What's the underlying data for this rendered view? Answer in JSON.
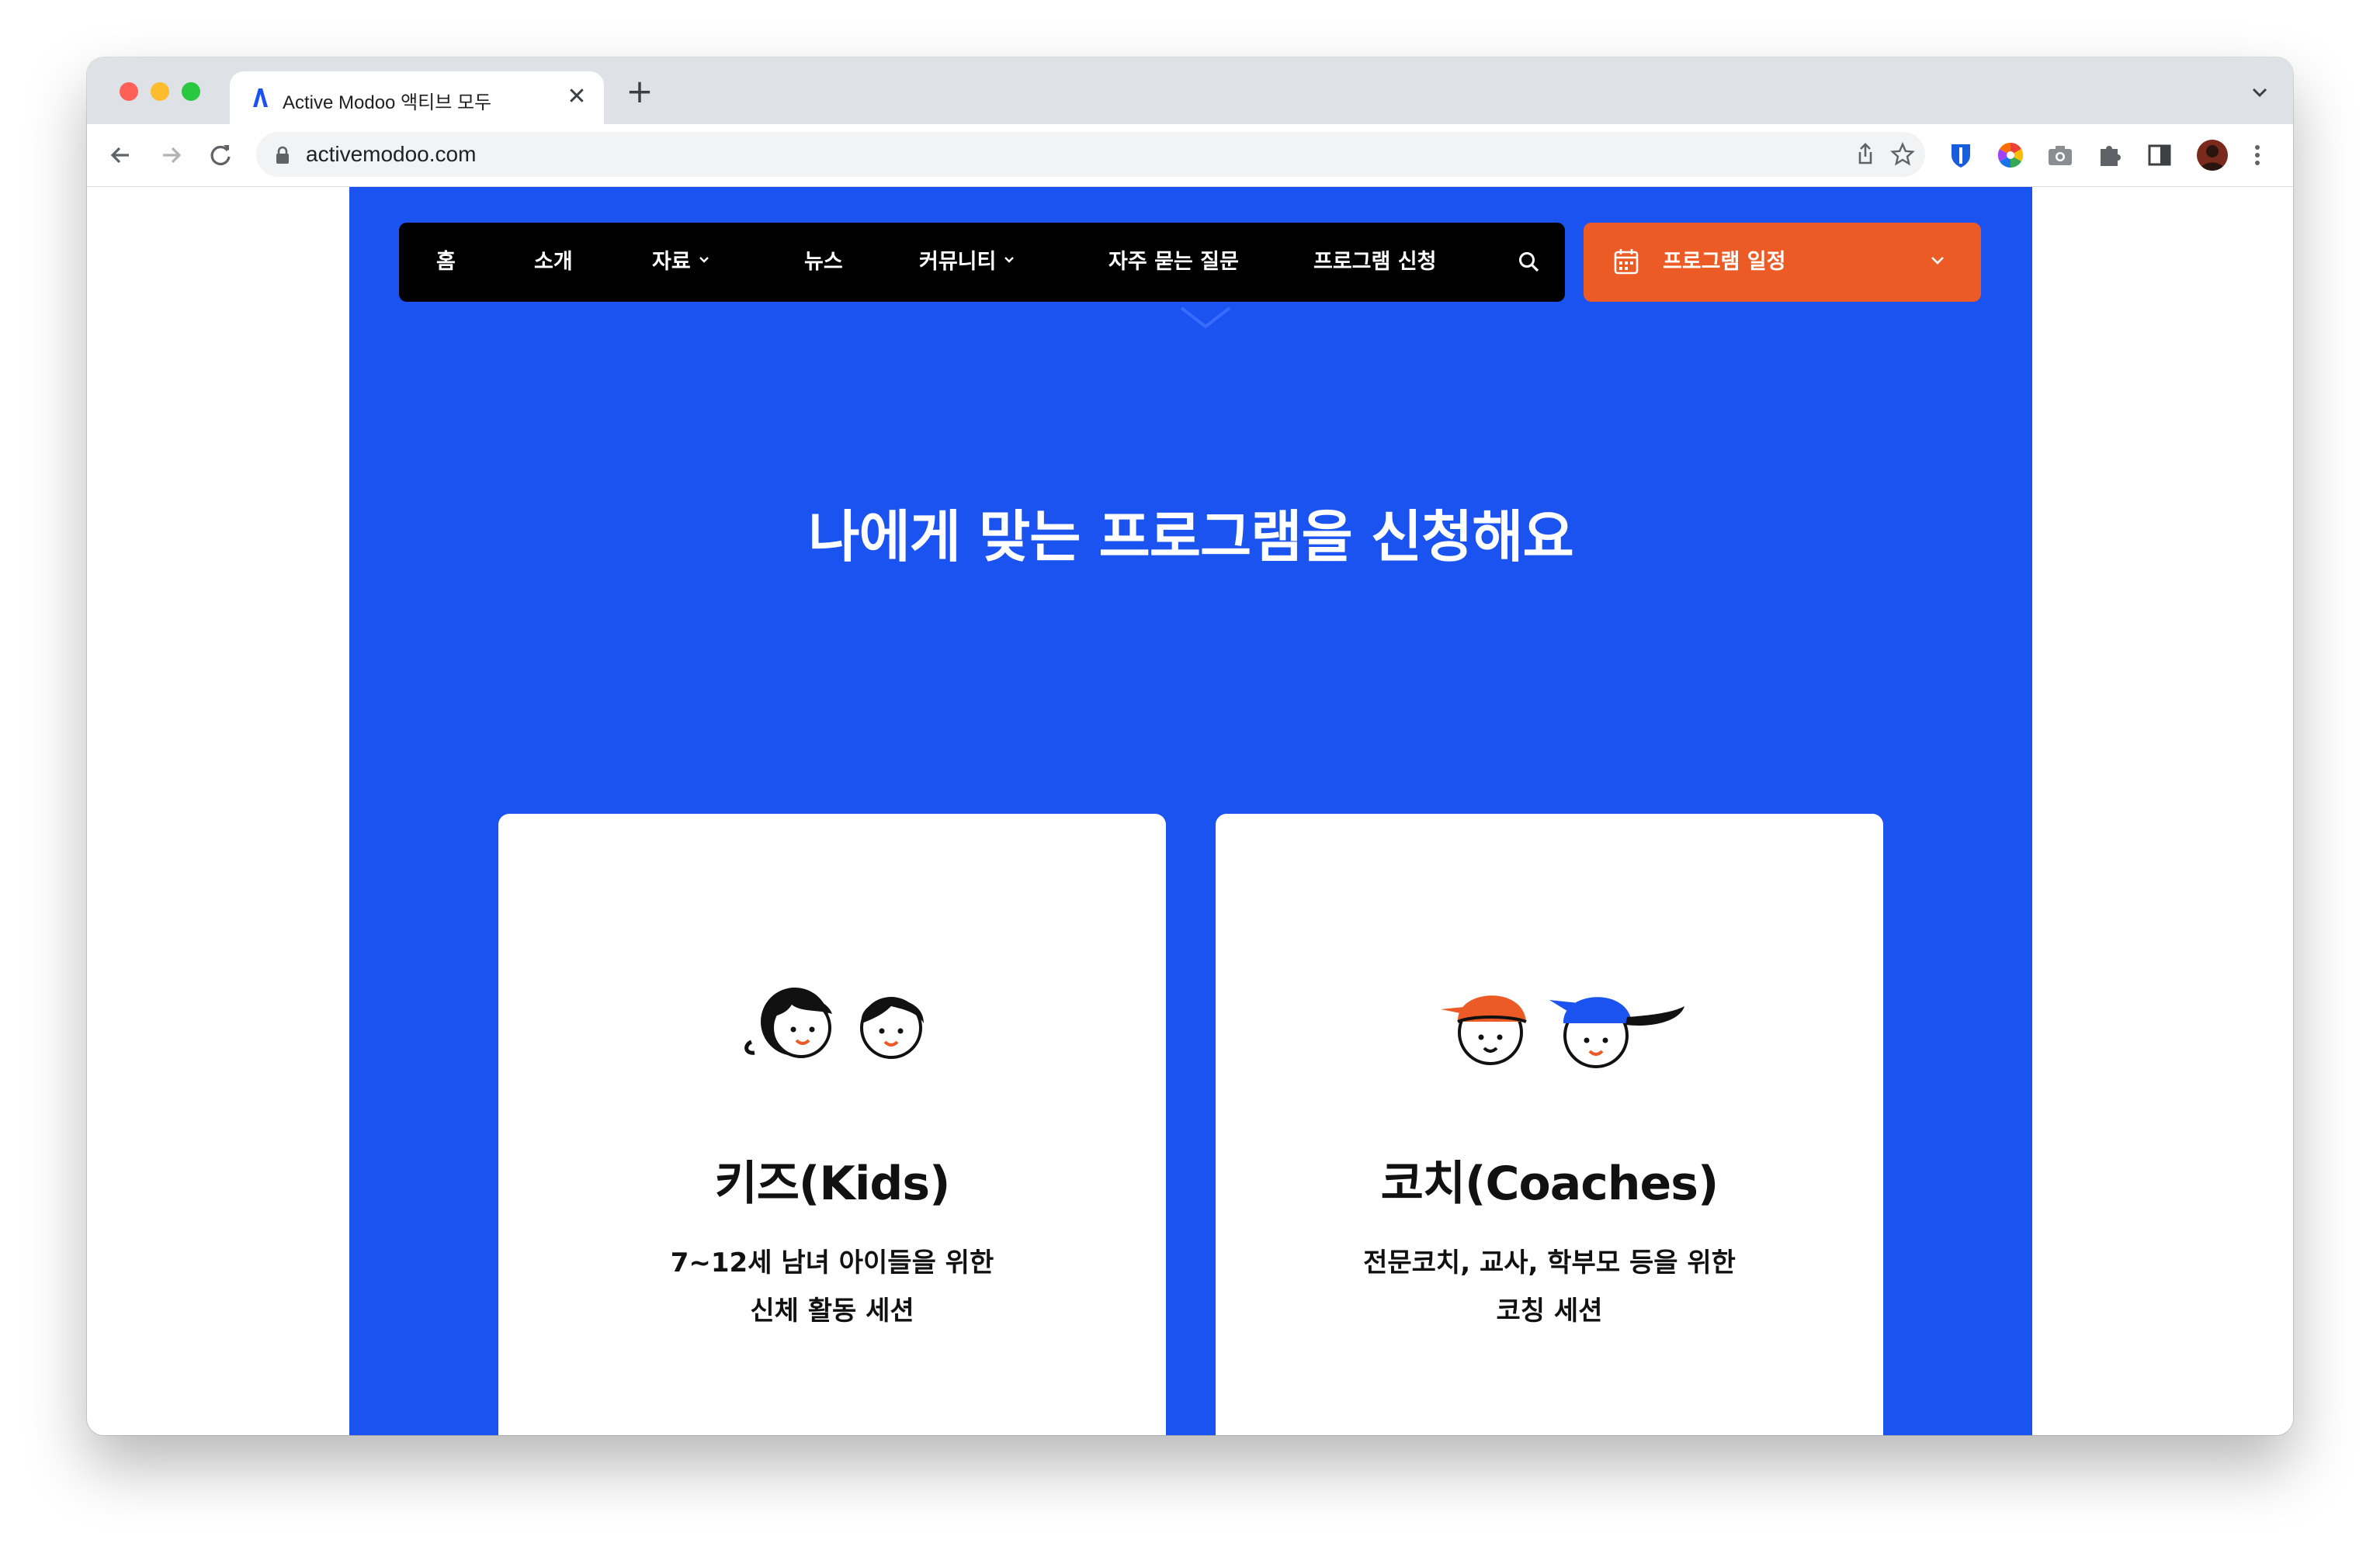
{
  "browser": {
    "tab_title": "Active Modoo 액티브 모두",
    "new_tab_label": "+",
    "close_label": "✕",
    "url": "activemodoo.com"
  },
  "nav": {
    "items": [
      {
        "label": "홈",
        "dropdown": false
      },
      {
        "label": "소개",
        "dropdown": false
      },
      {
        "label": "자료",
        "dropdown": true
      },
      {
        "label": "뉴스",
        "dropdown": false
      },
      {
        "label": "커뮤니티",
        "dropdown": true
      },
      {
        "label": "자주 묻는 질문",
        "dropdown": false
      },
      {
        "label": "프로그램 신청",
        "dropdown": false
      }
    ],
    "schedule_label": "프로그램 일정"
  },
  "hero": {
    "heading": "나에게 맞는 프로그램을 신청해요"
  },
  "cards": [
    {
      "title": "키즈(Kids)",
      "desc_line1": "7~12세 남녀 아이들을 위한",
      "desc_line2": "신체 활동 세션"
    },
    {
      "title": "코치(Coaches)",
      "desc_line1": "전문코치, 교사, 학부모 등을 위한",
      "desc_line2": "코칭 세션"
    }
  ],
  "colors": {
    "brand_blue": "#1a53f0",
    "accent_orange": "#ec5b26",
    "nav_black": "#000000"
  }
}
